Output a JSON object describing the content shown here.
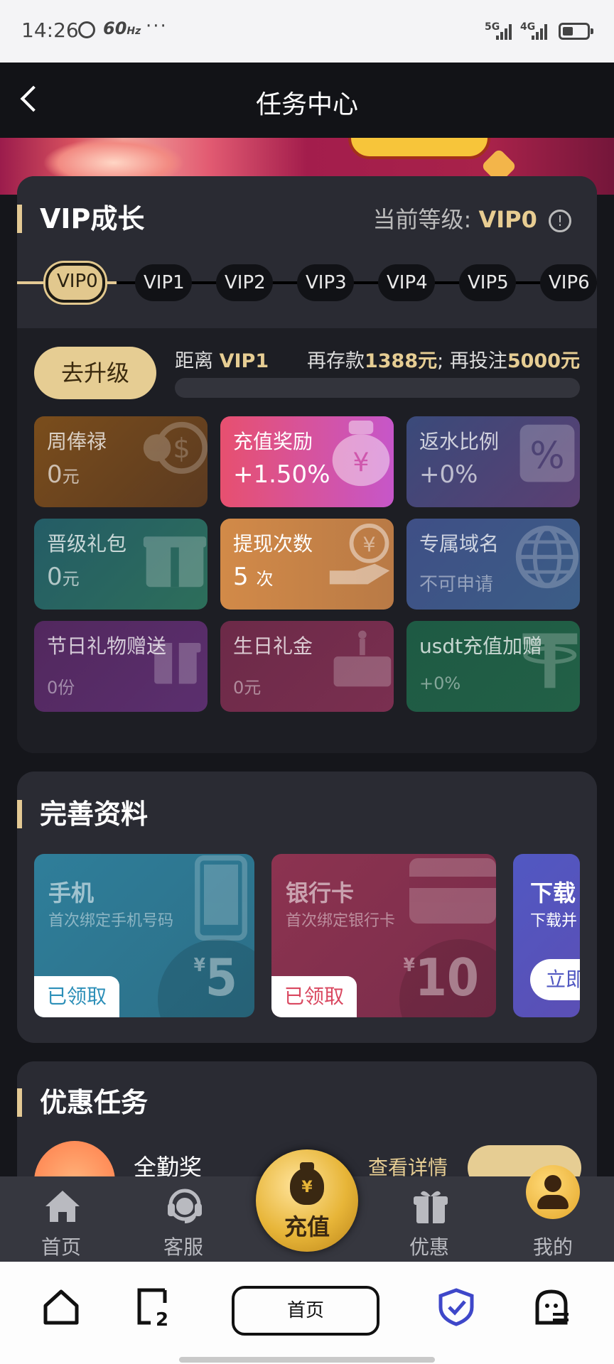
{
  "status": {
    "time": "14:26",
    "refresh": "60",
    "refresh_unit": "Hz",
    "more": "···",
    "sim1": "5G",
    "sim2": "4G"
  },
  "header": {
    "title": "任务中心"
  },
  "vip": {
    "title": "VIP成长",
    "level_label": "当前等级:",
    "level_value": "VIP0",
    "levels": [
      "VIP0",
      "VIP1",
      "VIP2",
      "VIP3",
      "VIP4",
      "VIP5",
      "VIP6"
    ],
    "upgrade_button": "去升级",
    "distance_label": "距离",
    "distance_target": "VIP1",
    "deposit_label": "再存款",
    "deposit_value": "1388元",
    "separator": ";",
    "bet_label": "再投注",
    "bet_value": "5000元",
    "tiles": [
      {
        "label": "周俸禄",
        "value": "0",
        "unit": "元"
      },
      {
        "label": "充值奖励",
        "value": "+1.50%",
        "unit": ""
      },
      {
        "label": "返水比例",
        "value": "+0%",
        "unit": ""
      },
      {
        "label": "晋级礼包",
        "value": "0",
        "unit": "元"
      },
      {
        "label": "提现次数",
        "value": "5",
        "unit": "次"
      },
      {
        "label": "专属域名",
        "value": "不可申请",
        "unit": ""
      },
      {
        "label": "节日礼物赠送",
        "value": "0份",
        "unit": ""
      },
      {
        "label": "生日礼金",
        "value": "0元",
        "unit": ""
      },
      {
        "label": "usdt充值加赠",
        "value": "+0%",
        "unit": ""
      }
    ]
  },
  "profile": {
    "title": "完善资料",
    "cards": [
      {
        "title": "手机",
        "desc": "首次绑定手机号码",
        "button": "已领取",
        "currency": "¥",
        "amount": "5"
      },
      {
        "title": "银行卡",
        "desc": "首次绑定银行卡",
        "button": "已领取",
        "currency": "¥",
        "amount": "10"
      },
      {
        "title": "下载",
        "desc": "下载并",
        "button": "立即"
      }
    ]
  },
  "tasks": {
    "title": "优惠任务",
    "item_name": "全勤奖",
    "details_link": "查看详情"
  },
  "app_nav": {
    "home": "首页",
    "service": "客服",
    "recharge": "充值",
    "recharge_symbol": "¥",
    "promo": "优惠",
    "mine": "我的"
  },
  "browser": {
    "home": "首页",
    "tabs_count": "2"
  },
  "colors": {
    "gold": "#e6cd93",
    "background": "#15161b",
    "card": "#2a2b33"
  }
}
